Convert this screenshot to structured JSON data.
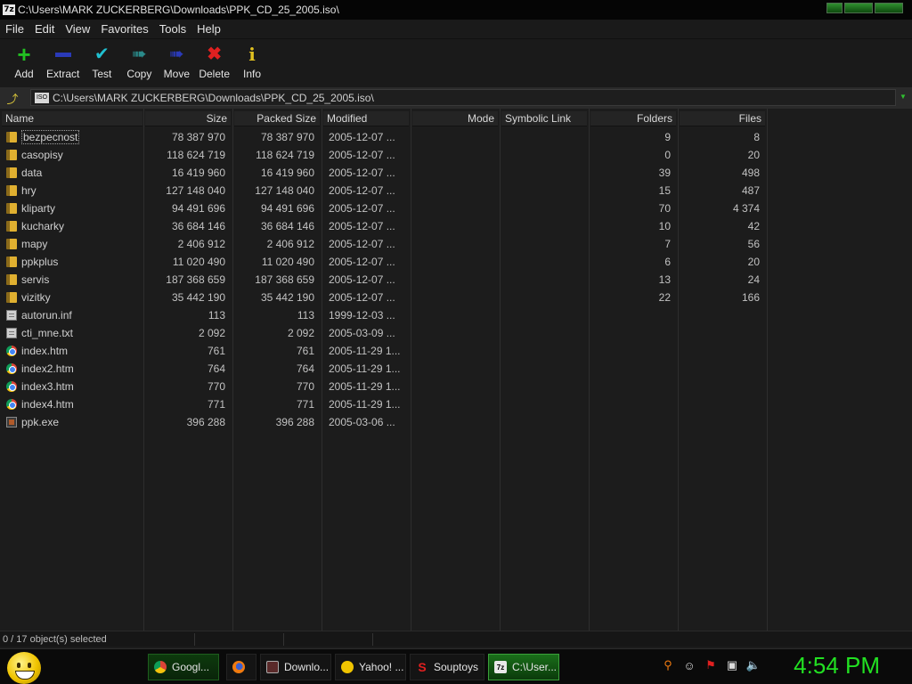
{
  "window": {
    "title": "C:\\Users\\MARK ZUCKERBERG\\Downloads\\PPK_CD_25_2005.iso\\",
    "app_icon_text": "7z"
  },
  "menu": [
    "File",
    "Edit",
    "View",
    "Favorites",
    "Tools",
    "Help"
  ],
  "toolbar": {
    "add": "Add",
    "extract": "Extract",
    "test": "Test",
    "copy": "Copy",
    "move": "Move",
    "delete": "Delete",
    "info": "Info"
  },
  "address": {
    "path": "C:\\Users\\MARK ZUCKERBERG\\Downloads\\PPK_CD_25_2005.iso\\",
    "iso_label": "ISO"
  },
  "columns": {
    "name": "Name",
    "size": "Size",
    "packed": "Packed Size",
    "modified": "Modified",
    "mode": "Mode",
    "symlink": "Symbolic Link",
    "folders": "Folders",
    "files": "Files"
  },
  "rows": [
    {
      "name": "bezpecnost",
      "type": "folder",
      "size": "78 387 970",
      "packed": "78 387 970",
      "modified": "2005-12-07 ...",
      "folders": "9",
      "files": "8"
    },
    {
      "name": "casopisy",
      "type": "folder",
      "size": "118 624 719",
      "packed": "118 624 719",
      "modified": "2005-12-07 ...",
      "folders": "0",
      "files": "20"
    },
    {
      "name": "data",
      "type": "folder",
      "size": "16 419 960",
      "packed": "16 419 960",
      "modified": "2005-12-07 ...",
      "folders": "39",
      "files": "498"
    },
    {
      "name": "hry",
      "type": "folder",
      "size": "127 148 040",
      "packed": "127 148 040",
      "modified": "2005-12-07 ...",
      "folders": "15",
      "files": "487"
    },
    {
      "name": "kliparty",
      "type": "folder",
      "size": "94 491 696",
      "packed": "94 491 696",
      "modified": "2005-12-07 ...",
      "folders": "70",
      "files": "4 374"
    },
    {
      "name": "kucharky",
      "type": "folder",
      "size": "36 684 146",
      "packed": "36 684 146",
      "modified": "2005-12-07 ...",
      "folders": "10",
      "files": "42"
    },
    {
      "name": "mapy",
      "type": "folder",
      "size": "2 406 912",
      "packed": "2 406 912",
      "modified": "2005-12-07 ...",
      "folders": "7",
      "files": "56"
    },
    {
      "name": "ppkplus",
      "type": "folder",
      "size": "11 020 490",
      "packed": "11 020 490",
      "modified": "2005-12-07 ...",
      "folders": "6",
      "files": "20"
    },
    {
      "name": "servis",
      "type": "folder",
      "size": "187 368 659",
      "packed": "187 368 659",
      "modified": "2005-12-07 ...",
      "folders": "13",
      "files": "24"
    },
    {
      "name": "vizitky",
      "type": "folder",
      "size": "35 442 190",
      "packed": "35 442 190",
      "modified": "2005-12-07 ...",
      "folders": "22",
      "files": "166"
    },
    {
      "name": "autorun.inf",
      "type": "doc",
      "size": "113",
      "packed": "113",
      "modified": "1999-12-03 ...",
      "folders": "",
      "files": ""
    },
    {
      "name": "cti_mne.txt",
      "type": "doc",
      "size": "2 092",
      "packed": "2 092",
      "modified": "2005-03-09 ...",
      "folders": "",
      "files": ""
    },
    {
      "name": "index.htm",
      "type": "web",
      "size": "761",
      "packed": "761",
      "modified": "2005-11-29 1...",
      "folders": "",
      "files": ""
    },
    {
      "name": "index2.htm",
      "type": "web",
      "size": "764",
      "packed": "764",
      "modified": "2005-11-29 1...",
      "folders": "",
      "files": ""
    },
    {
      "name": "index3.htm",
      "type": "web",
      "size": "770",
      "packed": "770",
      "modified": "2005-11-29 1...",
      "folders": "",
      "files": ""
    },
    {
      "name": "index4.htm",
      "type": "web",
      "size": "771",
      "packed": "771",
      "modified": "2005-11-29 1...",
      "folders": "",
      "files": ""
    },
    {
      "name": "ppk.exe",
      "type": "exe",
      "size": "396 288",
      "packed": "396 288",
      "modified": "2005-03-06 ...",
      "folders": "",
      "files": ""
    }
  ],
  "status": {
    "text": "0 / 17 object(s) selected"
  },
  "taskbar": {
    "tasks": [
      {
        "label": "Googl...",
        "icon": "chrome-icon",
        "style": "green"
      },
      {
        "label": "",
        "icon": "firefox-icon",
        "style": "plain"
      },
      {
        "label": "Downlo...",
        "icon": "download-icon",
        "style": "plain"
      },
      {
        "label": "Yahoo! ...",
        "icon": "yahoo-icon",
        "style": "plain"
      },
      {
        "label": "Souptoys",
        "icon": "souptoys-icon",
        "style": "plain"
      },
      {
        "label": "C:\\User...",
        "icon": "7zip-icon",
        "style": "active"
      }
    ],
    "clock": "4:54 PM"
  },
  "colors": {
    "accent_green": "#22e022",
    "background": "#1c1c1c",
    "folder": "#e0b030"
  }
}
